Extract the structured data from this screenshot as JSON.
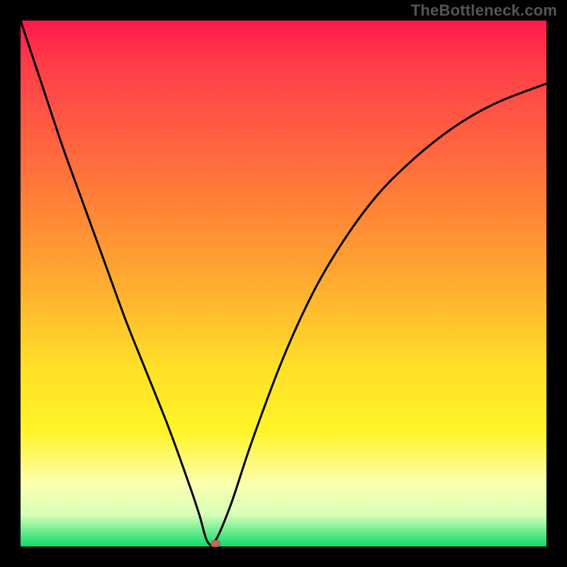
{
  "watermark": "TheBottleneck.com",
  "chart_data": {
    "type": "line",
    "title": "",
    "xlabel": "",
    "ylabel": "",
    "xlim": [
      0,
      100
    ],
    "ylim": [
      0,
      100
    ],
    "grid": false,
    "legend": false,
    "series": [
      {
        "name": "curve",
        "x": [
          0,
          4,
          8,
          12,
          16,
          20,
          24,
          28,
          32,
          34,
          35.5,
          37,
          40,
          44,
          50,
          56,
          62,
          68,
          74,
          80,
          86,
          92,
          100
        ],
        "y": [
          100,
          88,
          76,
          65,
          54,
          43,
          33,
          23,
          12,
          6,
          1,
          1,
          8,
          20,
          36,
          49,
          59,
          67,
          73,
          78,
          82,
          85,
          88
        ]
      }
    ],
    "marker": {
      "x": 37,
      "y": 0.5
    },
    "background_gradient": [
      "#ff1a4a",
      "#ff8a36",
      "#ffe028",
      "#fdffb0",
      "#0bdc6a"
    ]
  }
}
